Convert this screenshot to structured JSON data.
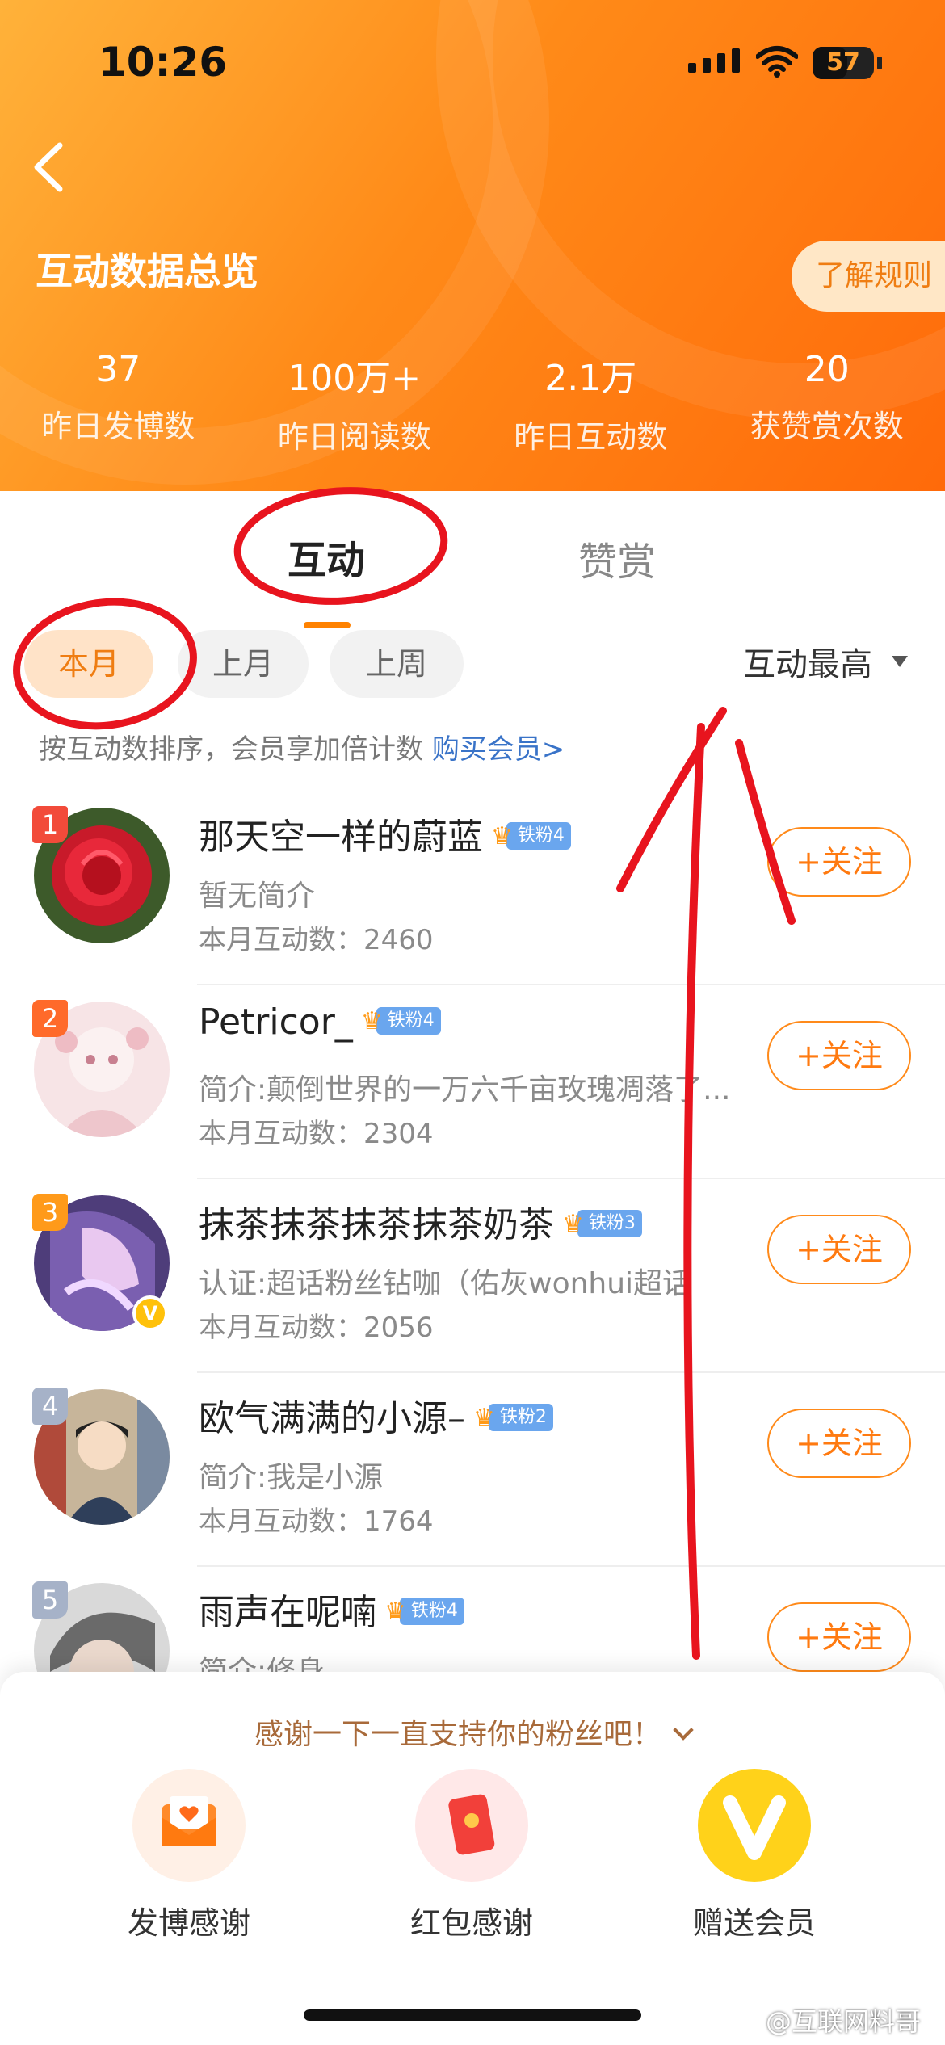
{
  "status_bar": {
    "time": "10:26",
    "battery": "57"
  },
  "header": {
    "title": "互动数据总览",
    "rules_button": "了解规则",
    "stats": [
      {
        "value": "37",
        "label": "昨日发博数"
      },
      {
        "value": "100万+",
        "label": "昨日阅读数"
      },
      {
        "value": "2.1万",
        "label": "昨日互动数"
      },
      {
        "value": "20",
        "label": "获赞赏次数"
      }
    ]
  },
  "tabs": {
    "active": "互动",
    "inactive": "赞赏"
  },
  "filters": {
    "this_month": "本月",
    "last_month": "上月",
    "last_week": "上周",
    "sort": "互动最高"
  },
  "hint": {
    "text": "按互动数排序，会员享加倍计数 ",
    "link": "购买会员>"
  },
  "fans": [
    {
      "rank": "1",
      "name": "那天空一样的蔚蓝",
      "badge": "铁粉4",
      "bio": "暂无简介",
      "count": "本月互动数：2460",
      "follow": "+关注"
    },
    {
      "rank": "2",
      "name": "Petricor_",
      "badge": "铁粉4",
      "bio": "简介:颠倒世界的一万六千亩玫瑰凋落了...",
      "count": "本月互动数：2304",
      "follow": "+关注"
    },
    {
      "rank": "3",
      "name": "抹茶抹茶抹茶抹茶奶茶",
      "badge": "铁粉3",
      "bio": "认证:超话粉丝钻咖（佑灰wonhui超话",
      "count": "本月互动数：2056",
      "follow": "+关注"
    },
    {
      "rank": "4",
      "name": "欧气满满的小源–",
      "badge": "铁粉2",
      "bio": "简介:我是小源",
      "count": "本月互动数：1764",
      "follow": "+关注"
    },
    {
      "rank": "5",
      "name": "雨声在呢喃",
      "badge": "铁粉4",
      "bio": "简介:修身",
      "count": "",
      "follow": "+关注"
    }
  ],
  "sheet": {
    "title": "感谢一下一直支持你的粉丝吧！",
    "actions": [
      {
        "label": "发博感谢",
        "icon": "envelope-heart-icon"
      },
      {
        "label": "红包感谢",
        "icon": "red-packet-icon"
      },
      {
        "label": "赠送会员",
        "icon": "vip-v-icon"
      }
    ]
  },
  "watermark": "@互联网料哥",
  "colors": {
    "accent": "#ff8200",
    "header_start": "#ffb23a",
    "header_end": "#ff6a0a",
    "annotation": "#e8141e",
    "link": "#3973c8"
  }
}
